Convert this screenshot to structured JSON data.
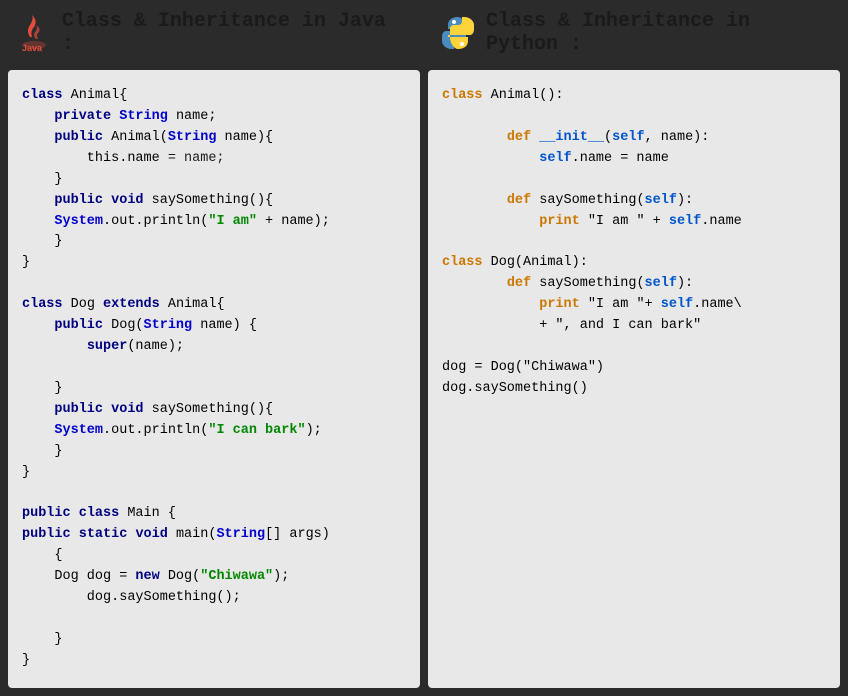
{
  "java_header": {
    "title": "Class & Inheritance in Java :",
    "icon": "☕"
  },
  "python_header": {
    "title": "Class & Inheritance in Python :",
    "icon": "🐍"
  }
}
